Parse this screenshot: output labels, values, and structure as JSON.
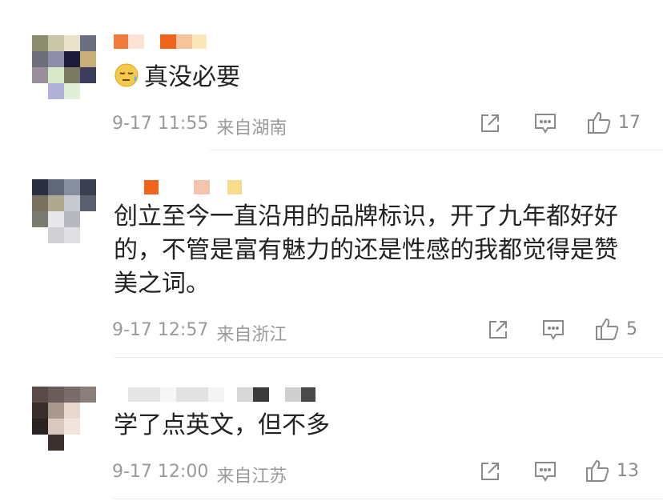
{
  "comments": [
    {
      "text": "真没必要",
      "emoji": "sweat-face-emoji",
      "date": "9-17 11:55",
      "location": "来自湖南",
      "likes": "17"
    },
    {
      "text_lines": [
        "创立至今一直沿用的品牌标识，开了九年都好好",
        "的，不管是富有魅力的还是性感的我都觉得是赞",
        "美之词。"
      ],
      "date": "9-17 12:57",
      "location": "来自浙江",
      "likes": "5"
    },
    {
      "text": "学了点英文，但不多",
      "date": "9-17 12:00",
      "location": "来自江苏",
      "likes": "13"
    }
  ],
  "icons": {
    "share": "share-icon",
    "reply": "comment-icon",
    "like": "thumbs-up-icon"
  },
  "colors": {
    "text": "#222222",
    "meta": "#9a9a9a",
    "divider": "#ececec",
    "name_orange": "#f0682a"
  }
}
